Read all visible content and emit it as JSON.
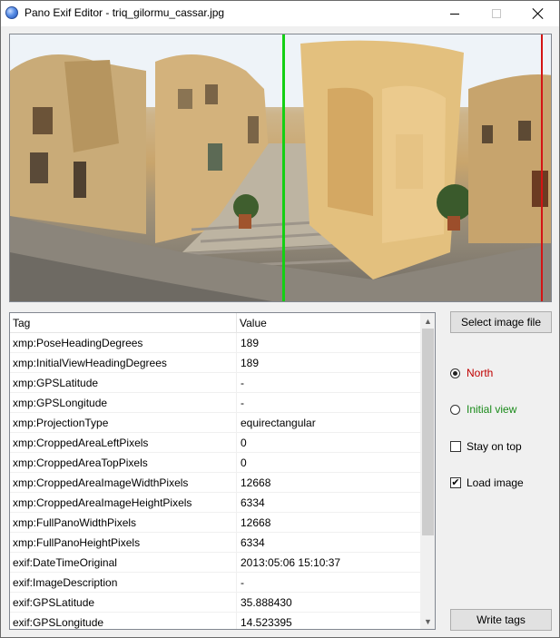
{
  "window": {
    "title": "Pano Exif Editor - triq_gilormu_cassar.jpg",
    "icons": {
      "app": "globe-icon",
      "minimize": "minimize-icon",
      "maximize": "maximize-icon",
      "close": "close-icon"
    }
  },
  "panorama": {
    "north_line_color": "#14d014",
    "initial_view_line_color": "#d41414"
  },
  "table": {
    "headers": {
      "tag": "Tag",
      "value": "Value"
    },
    "rows": [
      {
        "tag": "xmp:PoseHeadingDegrees",
        "value": "189"
      },
      {
        "tag": "xmp:InitialViewHeadingDegrees",
        "value": "189"
      },
      {
        "tag": "xmp:GPSLatitude",
        "value": "-"
      },
      {
        "tag": "xmp:GPSLongitude",
        "value": "-"
      },
      {
        "tag": "xmp:ProjectionType",
        "value": "equirectangular"
      },
      {
        "tag": "xmp:CroppedAreaLeftPixels",
        "value": "0"
      },
      {
        "tag": "xmp:CroppedAreaTopPixels",
        "value": "0"
      },
      {
        "tag": "xmp:CroppedAreaImageWidthPixels",
        "value": "12668"
      },
      {
        "tag": "xmp:CroppedAreaImageHeightPixels",
        "value": "6334"
      },
      {
        "tag": "xmp:FullPanoWidthPixels",
        "value": "12668"
      },
      {
        "tag": "xmp:FullPanoHeightPixels",
        "value": "6334"
      },
      {
        "tag": "exif:DateTimeOriginal",
        "value": "2013:05:06 15:10:37"
      },
      {
        "tag": "exif:ImageDescription",
        "value": "-"
      },
      {
        "tag": "exif:GPSLatitude",
        "value": "35.888430"
      },
      {
        "tag": "exif:GPSLongitude",
        "value": "14.523395"
      }
    ],
    "scroll_icons": {
      "up": "scroll-up-arrow-icon",
      "down": "scroll-down-arrow-icon"
    }
  },
  "controls": {
    "select_image_label": "Select image file",
    "north_label": "North",
    "north_color": "#c00000",
    "north_selected": true,
    "initial_view_label": "Initial view",
    "initial_view_color": "#1a8a1a",
    "initial_view_selected": false,
    "stay_on_top_label": "Stay on top",
    "stay_on_top_checked": false,
    "load_image_label": "Load image",
    "load_image_checked": true,
    "write_tags_label": "Write tags"
  }
}
